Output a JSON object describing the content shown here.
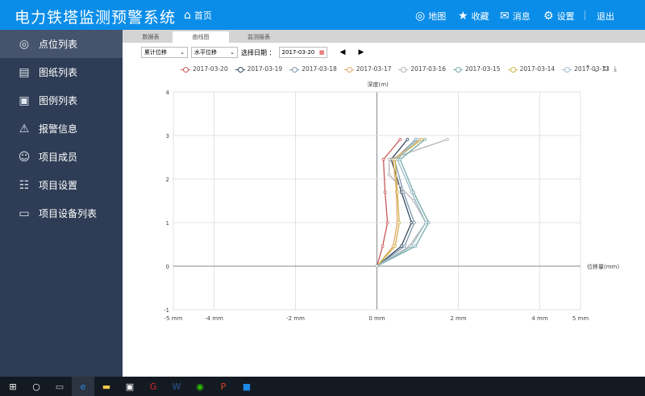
{
  "header": {
    "title": "电力铁塔监测预警系统",
    "home": "首页",
    "map": "地图",
    "favorites": "收藏",
    "messages": "消息",
    "settings": "设置",
    "logout": "退出"
  },
  "sidebar": {
    "items": [
      {
        "label": "点位列表",
        "icon": "location-pin-icon",
        "active": true
      },
      {
        "label": "图纸列表",
        "icon": "document-icon"
      },
      {
        "label": "图例列表",
        "icon": "image-icon"
      },
      {
        "label": "报警信息",
        "icon": "alarm-icon"
      },
      {
        "label": "项目成员",
        "icon": "users-icon"
      },
      {
        "label": "项目设置",
        "icon": "settings-icon"
      },
      {
        "label": "项目设备列表",
        "icon": "monitor-icon"
      }
    ]
  },
  "tabs": [
    {
      "label": "数据表"
    },
    {
      "label": "曲线图",
      "active": true
    },
    {
      "label": "监测报表"
    }
  ],
  "toolbar": {
    "type_select": "累计位移",
    "direction_select": "水平位移",
    "date_label": "选择日期 ：",
    "date_value": "2017-03-20"
  },
  "chart_data": {
    "type": "line",
    "ylabel": "深度(m)",
    "xlabel": "位移量(mm)",
    "xlim": [
      -5,
      5
    ],
    "ylim": [
      -1,
      4
    ],
    "xticks": [
      "-5 mm",
      "-4 mm",
      "-2 mm",
      "0 mm",
      "2 mm",
      "4 mm",
      "5 mm"
    ],
    "yticks": [
      "-1",
      "0",
      "1",
      "2",
      "3",
      "4"
    ],
    "grid": true,
    "legend": "top",
    "series": [
      {
        "name": "2017-03-20",
        "color": "#c9575b",
        "points": [
          [
            0,
            0
          ],
          [
            0.14,
            0.46
          ],
          [
            0.26,
            1
          ],
          [
            0.2,
            1.7
          ],
          [
            0.16,
            2.45
          ],
          [
            0.57,
            2.91
          ]
        ]
      },
      {
        "name": "2017-03-19",
        "color": "#34495e",
        "points": [
          [
            0,
            0
          ],
          [
            0.6,
            0.46
          ],
          [
            0.85,
            1
          ],
          [
            0.6,
            1.7
          ],
          [
            0.35,
            2.45
          ],
          [
            0.75,
            2.91
          ]
        ]
      },
      {
        "name": "2017-03-18",
        "color": "#7f98ab",
        "points": [
          [
            0,
            0
          ],
          [
            0.68,
            0.46
          ],
          [
            0.92,
            1
          ],
          [
            0.65,
            1.7
          ],
          [
            0.43,
            2.45
          ],
          [
            0.95,
            2.91
          ]
        ]
      },
      {
        "name": "2017-03-17",
        "color": "#e3a868",
        "points": [
          [
            0,
            0
          ],
          [
            0.4,
            0.46
          ],
          [
            0.5,
            1
          ],
          [
            0.48,
            1.7
          ],
          [
            0.4,
            2.45
          ],
          [
            1.05,
            2.91
          ]
        ]
      },
      {
        "name": "2017-03-16",
        "color": "#b5b5b5",
        "points": [
          [
            0,
            0
          ],
          [
            0.8,
            0.46
          ],
          [
            1.2,
            1
          ],
          [
            0.9,
            1.5
          ],
          [
            0.3,
            2.1
          ],
          [
            0.3,
            2.45
          ],
          [
            1.73,
            2.91
          ]
        ]
      },
      {
        "name": "2017-03-15",
        "color": "#72aaa8",
        "points": [
          [
            0,
            0
          ],
          [
            0.95,
            0.46
          ],
          [
            1.27,
            1
          ],
          [
            0.9,
            1.7
          ],
          [
            0.57,
            2.45
          ],
          [
            1.18,
            2.91
          ]
        ]
      },
      {
        "name": "2017-03-14",
        "color": "#cfb44c",
        "points": [
          [
            0,
            0
          ],
          [
            0.45,
            0.46
          ],
          [
            0.55,
            1
          ],
          [
            0.5,
            1.7
          ],
          [
            0.45,
            2.45
          ],
          [
            1.1,
            2.91
          ]
        ]
      },
      {
        "name": "2017-03-13",
        "color": "#9bbcc8",
        "points": [
          [
            0,
            0
          ],
          [
            0.85,
            0.46
          ],
          [
            1.2,
            1
          ],
          [
            0.85,
            1.7
          ],
          [
            0.5,
            2.45
          ],
          [
            1.0,
            2.91
          ]
        ]
      }
    ]
  },
  "taskbar": {
    "items": [
      "windows-start-icon",
      "search-icon",
      "task-view-icon",
      "edge-icon",
      "file-explorer-icon",
      "store-icon",
      "app-icon",
      "word-icon",
      "wechat-icon",
      "powerpoint-icon",
      "app-blue-icon"
    ]
  }
}
